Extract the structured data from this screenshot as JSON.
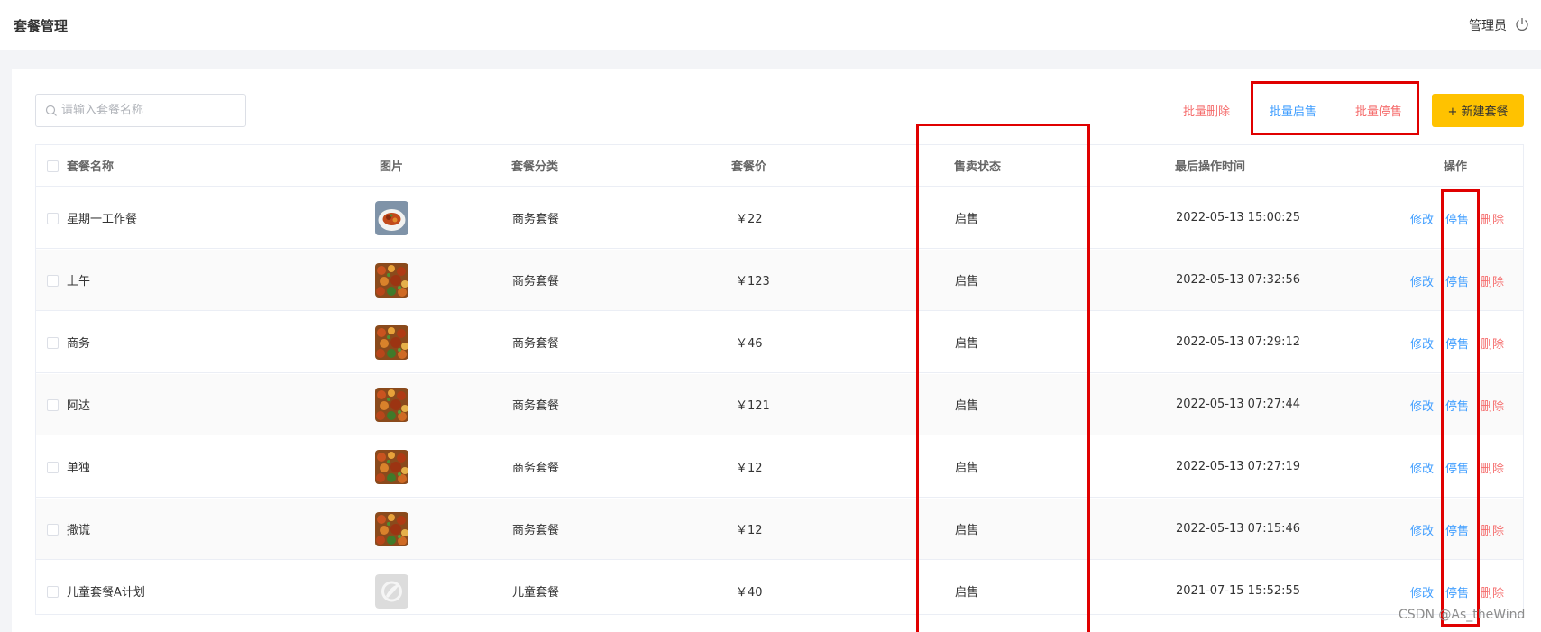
{
  "header": {
    "title": "套餐管理",
    "user": "管理员",
    "logout_icon": "power-icon"
  },
  "toolbar": {
    "search_placeholder": "请输入套餐名称",
    "batch_delete": "批量删除",
    "batch_on_sale": "批量启售",
    "batch_stop_sale": "批量停售",
    "new_button": "+ 新建套餐"
  },
  "table": {
    "columns": [
      "套餐名称",
      "图片",
      "套餐分类",
      "套餐价",
      "售卖状态",
      "最后操作时间",
      "操作"
    ],
    "actions": {
      "edit": "修改",
      "stop": "停售",
      "delete": "删除"
    },
    "rows": [
      {
        "name": "星期一工作餐",
        "category": "商务套餐",
        "price": "￥22",
        "status": "启售",
        "time": "2022-05-13 15:00:25",
        "image": "dish-plate"
      },
      {
        "name": "上午",
        "category": "商务套餐",
        "price": "￥123",
        "status": "启售",
        "time": "2022-05-13 07:32:56",
        "image": "dish-stirfry"
      },
      {
        "name": "商务",
        "category": "商务套餐",
        "price": "￥46",
        "status": "启售",
        "time": "2022-05-13 07:29:12",
        "image": "dish-stirfry"
      },
      {
        "name": "阿达",
        "category": "商务套餐",
        "price": "￥121",
        "status": "启售",
        "time": "2022-05-13 07:27:44",
        "image": "dish-stirfry"
      },
      {
        "name": "单独",
        "category": "商务套餐",
        "price": "￥12",
        "status": "启售",
        "time": "2022-05-13 07:27:19",
        "image": "dish-stirfry"
      },
      {
        "name": "撒谎",
        "category": "商务套餐",
        "price": "￥12",
        "status": "启售",
        "time": "2022-05-13 07:15:46",
        "image": "dish-stirfry"
      },
      {
        "name": "儿童套餐A计划",
        "category": "儿童套餐",
        "price": "￥40",
        "status": "启售",
        "time": "2021-07-15 15:52:55",
        "image": "placeholder-logo"
      }
    ]
  },
  "watermark": "CSDN @As_theWind",
  "colors": {
    "accent": "#409eff",
    "danger": "#f56c6c",
    "primary_button": "#ffc200",
    "annotation": "#e00000"
  }
}
